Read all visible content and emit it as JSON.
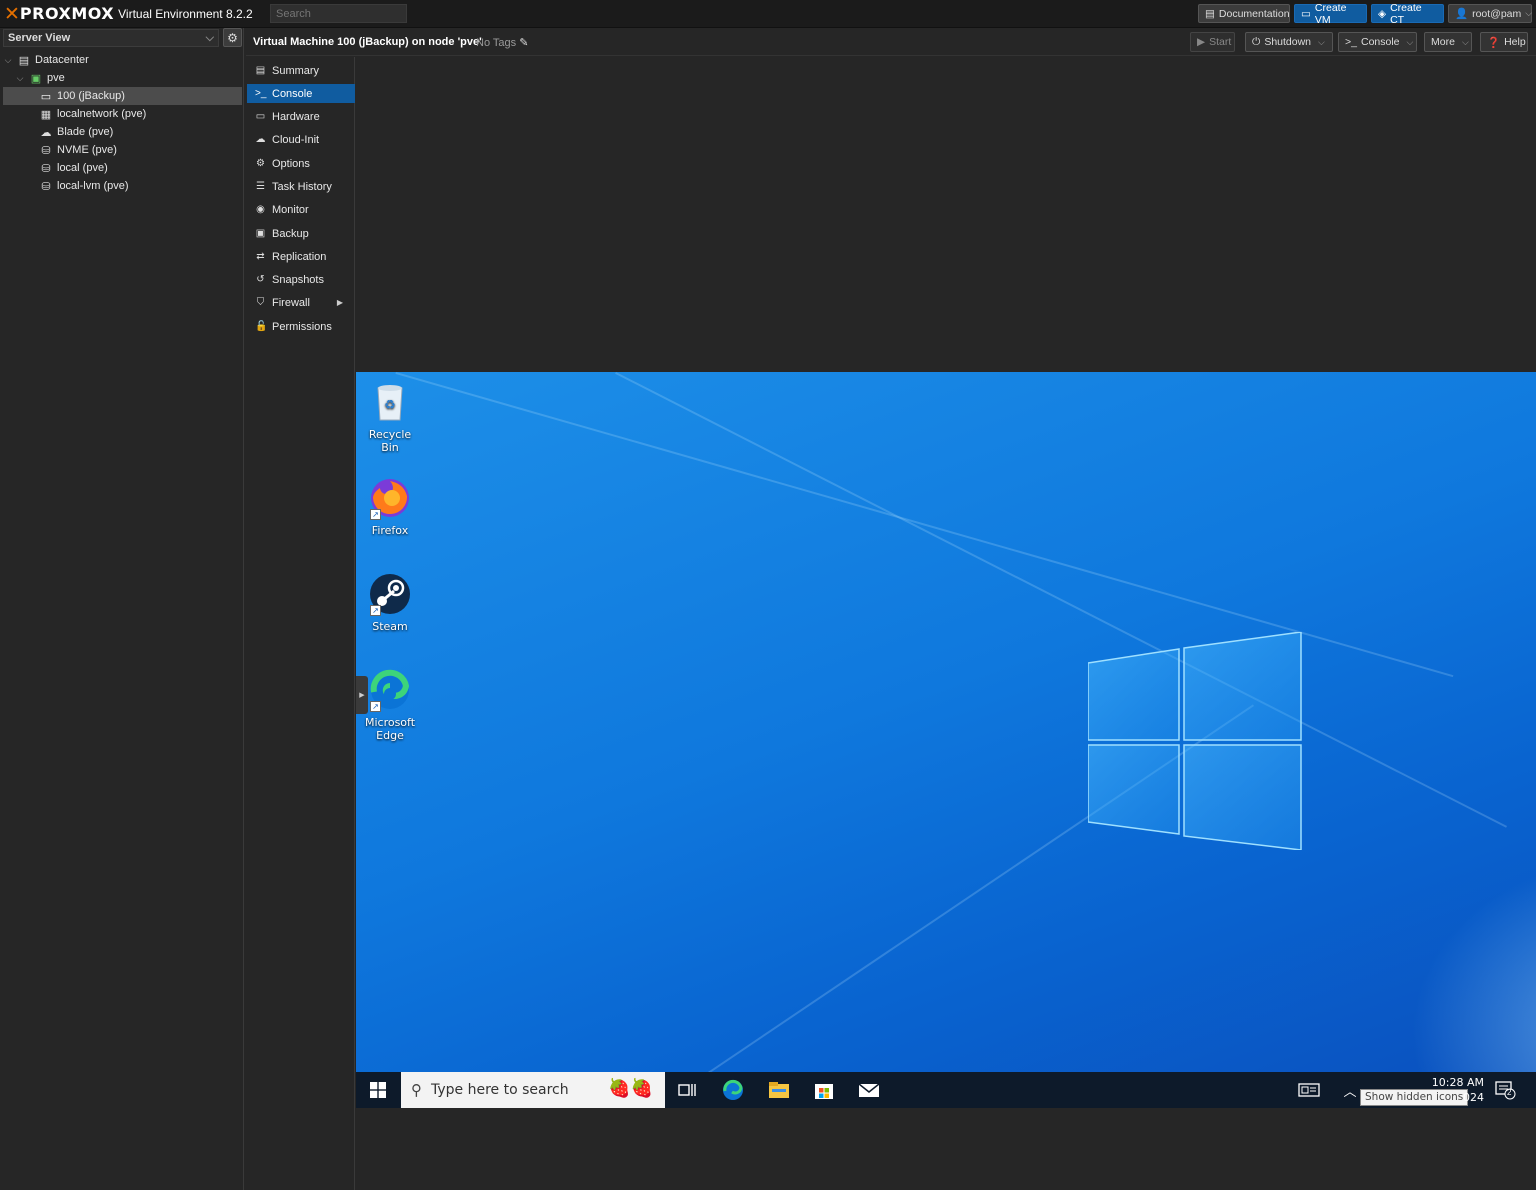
{
  "topbar": {
    "logo_text": "PROXMOX",
    "version": "Virtual Environment 8.2.2",
    "search_placeholder": "Search",
    "buttons": {
      "documentation": "Documentation",
      "create_vm": "Create VM",
      "create_ct": "Create CT",
      "user": "root@pam"
    }
  },
  "tree": {
    "view": "Server View",
    "items": [
      {
        "label": "Datacenter"
      },
      {
        "label": "pve"
      },
      {
        "label": "100 (jBackup)"
      },
      {
        "label": "localnetwork (pve)"
      },
      {
        "label": "Blade (pve)"
      },
      {
        "label": "NVME (pve)"
      },
      {
        "label": "local (pve)"
      },
      {
        "label": "local-lvm (pve)"
      }
    ]
  },
  "header": {
    "title": "Virtual Machine 100 (jBackup) on node 'pve'",
    "tags": "No Tags",
    "buttons": {
      "start": "Start",
      "shutdown": "Shutdown",
      "console": "Console",
      "more": "More",
      "help": "Help"
    }
  },
  "menu": {
    "items": [
      {
        "label": "Summary"
      },
      {
        "label": "Console"
      },
      {
        "label": "Hardware"
      },
      {
        "label": "Cloud-Init"
      },
      {
        "label": "Options"
      },
      {
        "label": "Task History"
      },
      {
        "label": "Monitor"
      },
      {
        "label": "Backup"
      },
      {
        "label": "Replication"
      },
      {
        "label": "Snapshots"
      },
      {
        "label": "Firewall"
      },
      {
        "label": "Permissions"
      }
    ],
    "active": "Console"
  },
  "desktop": {
    "icons": [
      {
        "label": "Recycle Bin",
        "icon": "recycle-bin-icon"
      },
      {
        "label": "Firefox",
        "icon": "firefox-icon"
      },
      {
        "label": "Steam",
        "icon": "steam-icon"
      },
      {
        "label": "Microsoft Edge",
        "icon": "edge-icon"
      }
    ],
    "taskbar": {
      "search_placeholder": "Type here to search",
      "time": "10:28 AM",
      "date_fragment": "024",
      "tooltip": "Show hidden icons",
      "notifications": "2"
    }
  },
  "colors": {
    "accent": "#105ca0",
    "proxmox_orange": "#e57000",
    "desktop_blue": "#0f78dd"
  }
}
